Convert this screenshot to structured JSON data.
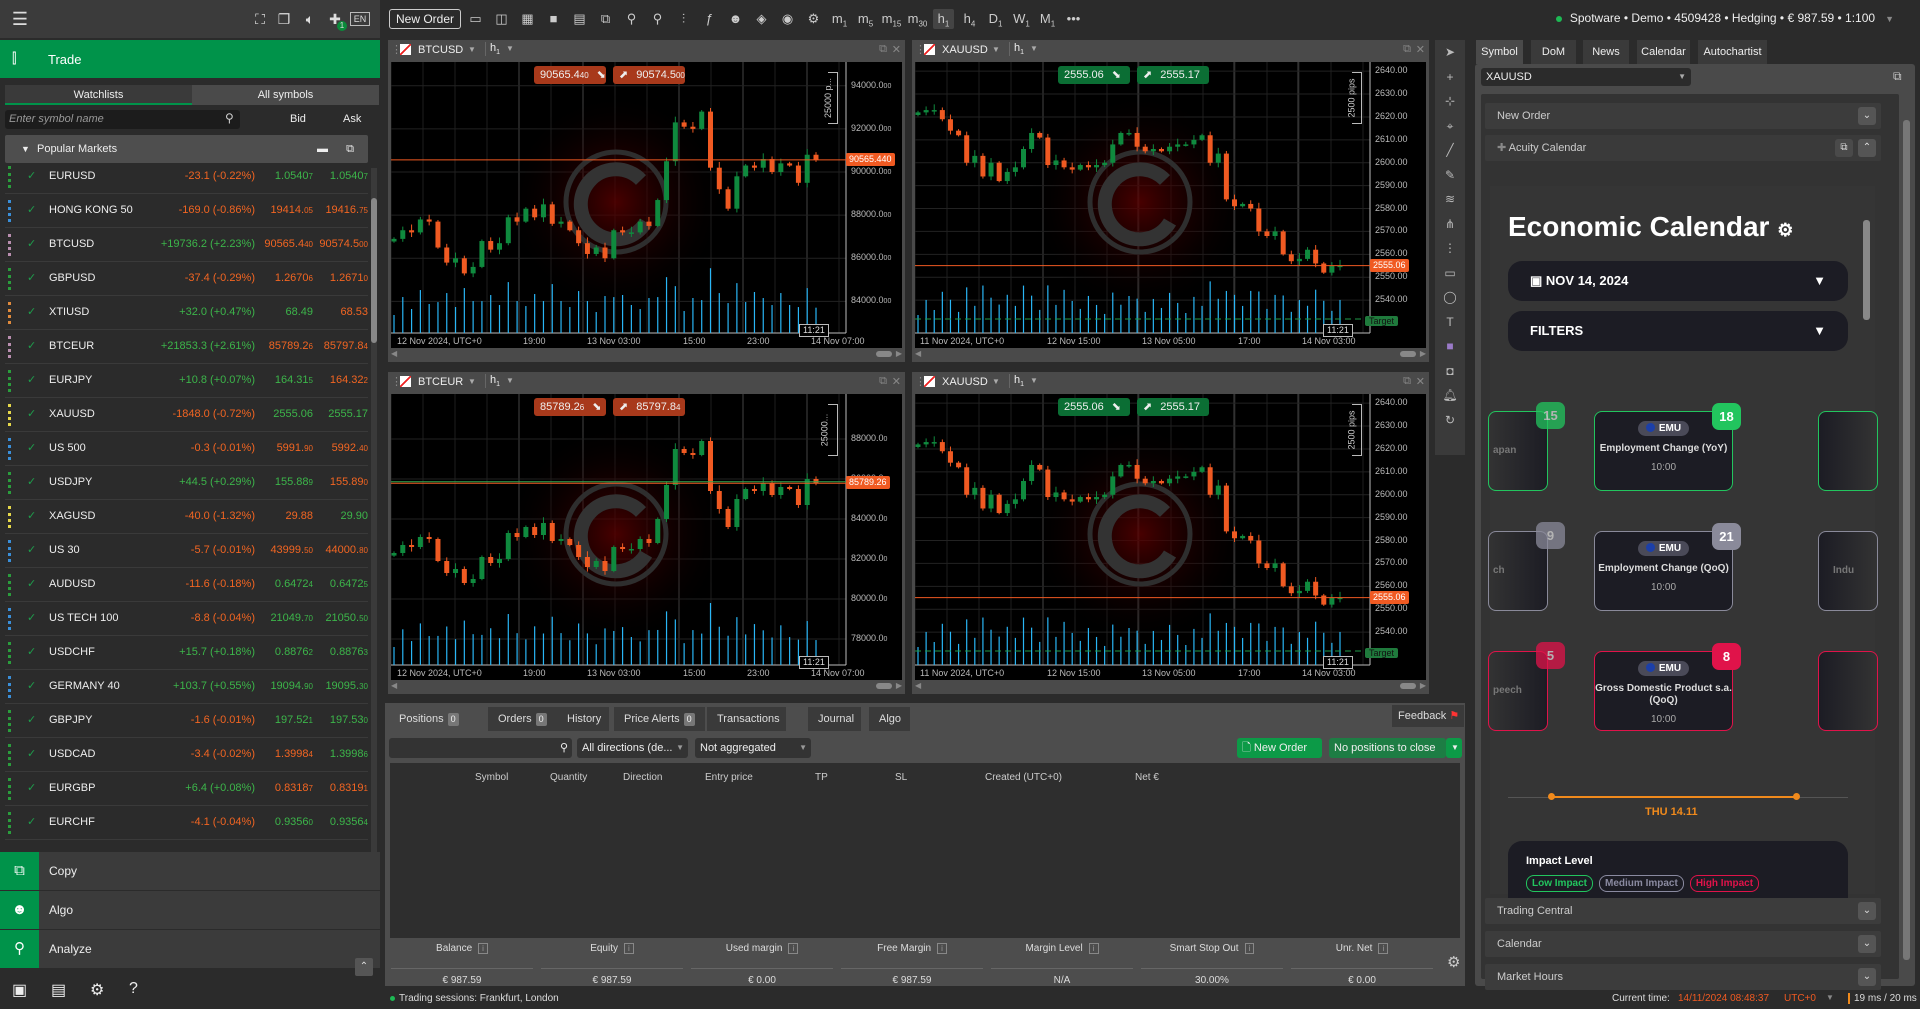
{
  "topbar": {
    "new_order": "New Order",
    "language": "EN",
    "plugin_badge": "1",
    "left_icons": [
      "fullscreen-icon",
      "duplicate-icon",
      "sound-icon",
      "plugin-icon"
    ],
    "tools": [
      {
        "name": "new-chart-icon",
        "g": "▭"
      },
      {
        "name": "layout-icon",
        "g": "◫"
      },
      {
        "name": "grid-4-icon",
        "g": "▦"
      },
      {
        "name": "single-view-icon",
        "g": "■"
      },
      {
        "name": "multi-view-icon",
        "g": "▤"
      },
      {
        "name": "add-chart-icon",
        "g": "⧉"
      },
      {
        "name": "zoom-out-icon",
        "g": "⚲"
      },
      {
        "name": "zoom-in-icon",
        "g": "⚲"
      },
      {
        "name": "chart-type-icon",
        "g": "⫶"
      },
      {
        "name": "indicator-icon",
        "g": "ƒ"
      },
      {
        "name": "bot-icon",
        "g": "☻"
      },
      {
        "name": "layers-icon",
        "g": "◈"
      },
      {
        "name": "eye-icon",
        "g": "◉"
      },
      {
        "name": "chart-settings-icon",
        "g": "⚙"
      }
    ],
    "timeframes": [
      {
        "l": "m",
        "s": "1"
      },
      {
        "l": "m",
        "s": "5"
      },
      {
        "l": "m",
        "s": "15"
      },
      {
        "l": "m",
        "s": "30"
      },
      {
        "l": "h",
        "s": "1"
      },
      {
        "l": "h",
        "s": "4"
      },
      {
        "l": "D",
        "s": "1"
      },
      {
        "l": "W",
        "s": "1"
      },
      {
        "l": "M",
        "s": "1"
      }
    ],
    "active_timeframe": "h1",
    "more": "•••",
    "account": "Spotware • Demo • 4509428 • Hedging • € 987.59 • 1:100"
  },
  "left": {
    "section": "Trade",
    "tabs": [
      "Watchlists",
      "All symbols"
    ],
    "active_tab": "Watchlists",
    "search_placeholder": "Enter symbol name",
    "bid": "Bid",
    "ask": "Ask",
    "group": "Popular Markets",
    "rows": [
      {
        "name": "EURUSD",
        "chg": "-23.1 (-0.22%)",
        "cd": "dn",
        "bid": "1.0540",
        "bs": "7",
        "bd": "up",
        "ask": "1.0540",
        "as": "7",
        "ad": "up",
        "bar": "#2a9d3c"
      },
      {
        "name": "HONG KONG 50",
        "chg": "-169.0 (-0.86%)",
        "cd": "dn",
        "bid": "19414.",
        "bs": "05",
        "bd": "dn",
        "ask": "19416.",
        "as": "75",
        "ad": "dn",
        "bar": "#3a8fd9"
      },
      {
        "name": "BTCUSD",
        "chg": "+19736.2 (+2.23%)",
        "cd": "up",
        "bid": "90565.4",
        "bs": "40",
        "bd": "dn",
        "ask": "90574.5",
        "as": "00",
        "ad": "dn",
        "bar": "#b98fb0"
      },
      {
        "name": "GBPUSD",
        "chg": "-37.4 (-0.29%)",
        "cd": "dn",
        "bid": "1.2670",
        "bs": "6",
        "bd": "dn",
        "ask": "1.2671",
        "as": "0",
        "ad": "dn",
        "bar": "#2a9d3c"
      },
      {
        "name": "XTIUSD",
        "chg": "+32.0 (+0.47%)",
        "cd": "up",
        "bid": "68.49",
        "bs": "",
        "bd": "up",
        "ask": "68.53",
        "as": "",
        "ad": "dn",
        "bar": "#e08a3c"
      },
      {
        "name": "BTCEUR",
        "chg": "+21853.3 (+2.61%)",
        "cd": "up",
        "bid": "85789.2",
        "bs": "6",
        "bd": "dn",
        "ask": "85797.8",
        "as": "4",
        "ad": "dn",
        "bar": "#b98fb0"
      },
      {
        "name": "EURJPY",
        "chg": "+10.8 (+0.07%)",
        "cd": "up",
        "bid": "164.31",
        "bs": "5",
        "bd": "up",
        "ask": "164.32",
        "as": "2",
        "ad": "dn",
        "bar": "#2a9d3c"
      },
      {
        "name": "XAUUSD",
        "chg": "-1848.0 (-0.72%)",
        "cd": "dn",
        "bid": "2555.06",
        "bs": "",
        "bd": "up",
        "ask": "2555.17",
        "as": "",
        "ad": "up",
        "bar": "#e6d84a"
      },
      {
        "name": "US 500",
        "chg": "-0.3 (-0.01%)",
        "cd": "dn",
        "bid": "5991.",
        "bs": "90",
        "bd": "dn",
        "ask": "5992.",
        "as": "40",
        "ad": "dn",
        "bar": "#3a8fd9"
      },
      {
        "name": "USDJPY",
        "chg": "+44.5 (+0.29%)",
        "cd": "up",
        "bid": "155.88",
        "bs": "9",
        "bd": "up",
        "ask": "155.89",
        "as": "0",
        "ad": "dn",
        "bar": "#2a9d3c"
      },
      {
        "name": "XAGUSD",
        "chg": "-40.0 (-1.32%)",
        "cd": "dn",
        "bid": "29.88",
        "bs": "",
        "bd": "dn",
        "ask": "29.90",
        "as": "",
        "ad": "up",
        "bar": "#e6d84a"
      },
      {
        "name": "US 30",
        "chg": "-5.7 (-0.01%)",
        "cd": "dn",
        "bid": "43999.",
        "bs": "50",
        "bd": "dn",
        "ask": "44000.",
        "as": "80",
        "ad": "dn",
        "bar": "#3a8fd9"
      },
      {
        "name": "AUDUSD",
        "chg": "-11.6 (-0.18%)",
        "cd": "dn",
        "bid": "0.6472",
        "bs": "4",
        "bd": "up",
        "ask": "0.6472",
        "as": "5",
        "ad": "up",
        "bar": "#2a9d3c"
      },
      {
        "name": "US TECH 100",
        "chg": "-8.8 (-0.04%)",
        "cd": "dn",
        "bid": "21049.",
        "bs": "70",
        "bd": "up",
        "ask": "21050.",
        "as": "50",
        "ad": "up",
        "bar": "#3a8fd9"
      },
      {
        "name": "USDCHF",
        "chg": "+15.7 (+0.18%)",
        "cd": "up",
        "bid": "0.8876",
        "bs": "2",
        "bd": "up",
        "ask": "0.8876",
        "as": "3",
        "ad": "up",
        "bar": "#2a9d3c"
      },
      {
        "name": "GERMANY 40",
        "chg": "+103.7 (+0.55%)",
        "cd": "up",
        "bid": "19094.",
        "bs": "90",
        "bd": "up",
        "ask": "19095.",
        "as": "30",
        "ad": "up",
        "bar": "#3a8fd9"
      },
      {
        "name": "GBPJPY",
        "chg": "-1.6 (-0.01%)",
        "cd": "dn",
        "bid": "197.52",
        "bs": "1",
        "bd": "up",
        "ask": "197.53",
        "as": "0",
        "ad": "up",
        "bar": "#2a9d3c"
      },
      {
        "name": "USDCAD",
        "chg": "-3.4 (-0.02%)",
        "cd": "dn",
        "bid": "1.3998",
        "bs": "4",
        "bd": "dn",
        "ask": "1.3998",
        "as": "6",
        "ad": "up",
        "bar": "#2a9d3c"
      },
      {
        "name": "EURGBP",
        "chg": "+6.4 (+0.08%)",
        "cd": "up",
        "bid": "0.8318",
        "bs": "7",
        "bd": "dn",
        "ask": "0.8319",
        "as": "1",
        "ad": "dn",
        "bar": "#2a9d3c"
      },
      {
        "name": "EURCHF",
        "chg": "-4.1 (-0.04%)",
        "cd": "dn",
        "bid": "0.9356",
        "bs": "0",
        "bd": "up",
        "ask": "0.9356",
        "as": "4",
        "ad": "up",
        "bar": "#2a9d3c"
      }
    ],
    "nav": [
      {
        "label": "Copy",
        "icon": "copy-icon",
        "g": "⧉"
      },
      {
        "label": "Algo",
        "icon": "robot-icon",
        "g": "☻"
      },
      {
        "label": "Analyze",
        "icon": "analyze-icon",
        "g": "⚲"
      }
    ],
    "footer_icons": [
      {
        "name": "deposit-icon",
        "g": "▣"
      },
      {
        "name": "wallet-icon",
        "g": "▤"
      },
      {
        "name": "settings-icon",
        "g": "⚙"
      },
      {
        "name": "help-icon",
        "g": "?"
      }
    ]
  },
  "charts": [
    {
      "symbol": "BTCUSD",
      "tf": "h",
      "tf_sub": "1",
      "bid": "90565.4",
      "bid_sub": "40",
      "ask": "90574.5",
      "ask_sub": "00",
      "quote_color": "#a8391b",
      "price_tag": "90565.440",
      "price_color": "#f05a22",
      "y_ticks": [
        "94000.0",
        "92000.0",
        "90000.0",
        "88000.0",
        "86000.0",
        "84000.0"
      ],
      "tick_values": [
        94000,
        92000,
        90000,
        88000,
        86000,
        84000
      ],
      "tick_suffix": "00",
      "y_range": [
        83000,
        95100
      ],
      "x_labels": [
        "12 Nov 2024, UTC+0",
        "19:00",
        "13 Nov 03:00",
        "15:00",
        "23:00",
        "14 Nov 07:00"
      ],
      "time_tag": "11:21",
      "ruler": "25000 p...",
      "closes": [
        86900,
        87300,
        87200,
        87800,
        87700,
        86500,
        85800,
        86000,
        85300,
        85600,
        86800,
        86400,
        86700,
        87900,
        87700,
        88300,
        87900,
        88500,
        87600,
        87700,
        87300,
        86700,
        86200,
        86500,
        86000,
        87300,
        87200,
        87200,
        87700,
        87500,
        88700,
        90500,
        92300,
        92100,
        92000,
        92800,
        90200,
        89200,
        88300,
        89800,
        90300,
        90200,
        90600,
        90000,
        90400,
        90300,
        89500,
        90800,
        90565
      ]
    },
    {
      "symbol": "XAUUSD",
      "tf": "h",
      "tf_sub": "1",
      "bid": "2555.06",
      "bid_sub": "",
      "ask": "2555.17",
      "ask_sub": "",
      "quote_color": "#0b6e34",
      "price_tag": "2555.06",
      "price_color": "#f05a22",
      "y_ticks": [
        "2640.00",
        "2630.00",
        "2620.00",
        "2610.00",
        "2600.00",
        "2590.00",
        "2580.00",
        "2570.00",
        "2560.00",
        "2550.00",
        "2540.00"
      ],
      "tick_values": [
        2640,
        2630,
        2620,
        2610,
        2600,
        2590,
        2580,
        2570,
        2560,
        2550,
        2540
      ],
      "tick_suffix": "",
      "y_range": [
        2530,
        2644
      ],
      "x_labels": [
        "11 Nov 2024, UTC+0",
        "12 Nov 15:00",
        "13 Nov 05:00",
        "17:00",
        "14 Nov 03:00"
      ],
      "time_tag": "11:21",
      "ruler": "2500 pips",
      "target": "Target",
      "closes": [
        2622,
        2623,
        2623,
        2619,
        2614,
        2612,
        2600,
        2603,
        2594,
        2600,
        2592,
        2596,
        2598,
        2606,
        2613,
        2611,
        2599,
        2601,
        2598,
        2597,
        2599,
        2598,
        2599,
        2600,
        2608,
        2613,
        2613,
        2607,
        2605,
        2606,
        2605,
        2607,
        2608,
        2608,
        2610,
        2612,
        2600,
        2604,
        2584,
        2581,
        2582,
        2580,
        2570,
        2568,
        2570,
        2560,
        2557,
        2558,
        2562,
        2556,
        2552,
        2555,
        2555.06
      ]
    },
    {
      "symbol": "BTCEUR",
      "tf": "h",
      "tf_sub": "1",
      "bid": "85789.2",
      "bid_sub": "6",
      "ask": "85797.8",
      "ask_sub": "4",
      "quote_color": "#a8391b",
      "price_tag": "85789.26",
      "price_color": "#f05a22",
      "second_line": "#2fa84f",
      "y_ticks": [
        "88000.0",
        "86000.0",
        "84000.0",
        "82000.0",
        "80000.0",
        "78000.0"
      ],
      "tick_values": [
        88000,
        86000,
        84000,
        82000,
        80000,
        78000
      ],
      "tick_suffix": "0",
      "y_range": [
        77200,
        90250
      ],
      "x_labels": [
        "12 Nov 2024, UTC+0",
        "19:00",
        "13 Nov 03:00",
        "15:00",
        "23:00",
        "14 Nov 07:00"
      ],
      "time_tag": "11:21",
      "ruler": "25000...",
      "closes": [
        82300,
        82700,
        82600,
        83100,
        83000,
        81900,
        81300,
        81500,
        80800,
        81000,
        82100,
        81800,
        82000,
        83300,
        83100,
        83600,
        83200,
        83800,
        82900,
        83000,
        82700,
        82100,
        81600,
        81900,
        81400,
        82600,
        82500,
        82500,
        83000,
        82800,
        84000,
        85700,
        87500,
        87300,
        87200,
        87900,
        85400,
        84500,
        83600,
        85000,
        85500,
        85400,
        85800,
        85200,
        85600,
        85500,
        84700,
        86000,
        85789
      ]
    },
    {
      "symbol": "XAUUSD",
      "tf": "h",
      "tf_sub": "1",
      "bid": "2555.06",
      "bid_sub": "",
      "ask": "2555.17",
      "ask_sub": "",
      "quote_color": "#0b6e34",
      "price_tag": "2555.06",
      "price_color": "#f05a22",
      "y_ticks": [
        "2640.00",
        "2630.00",
        "2620.00",
        "2610.00",
        "2600.00",
        "2590.00",
        "2580.00",
        "2570.00",
        "2560.00",
        "2550.00",
        "2540.00"
      ],
      "tick_values": [
        2640,
        2630,
        2620,
        2610,
        2600,
        2590,
        2580,
        2570,
        2560,
        2550,
        2540
      ],
      "tick_suffix": "",
      "y_range": [
        2530,
        2644
      ],
      "x_labels": [
        "11 Nov 2024, UTC+0",
        "12 Nov 15:00",
        "13 Nov 05:00",
        "17:00",
        "14 Nov 03:00"
      ],
      "time_tag": "11:21",
      "ruler": "2500 pips",
      "target": "Target",
      "closes": [
        2622,
        2623,
        2623,
        2619,
        2614,
        2612,
        2600,
        2603,
        2594,
        2600,
        2592,
        2596,
        2598,
        2606,
        2613,
        2611,
        2599,
        2601,
        2598,
        2597,
        2599,
        2598,
        2599,
        2600,
        2608,
        2613,
        2613,
        2607,
        2605,
        2606,
        2605,
        2607,
        2608,
        2608,
        2610,
        2612,
        2600,
        2604,
        2584,
        2581,
        2582,
        2580,
        2570,
        2568,
        2570,
        2560,
        2557,
        2558,
        2562,
        2556,
        2552,
        2555,
        2555.06
      ]
    }
  ],
  "drawing_tools": [
    "cursor-icon",
    "crosshair-icon",
    "crosshair-plus-icon",
    "crosshair-box-icon",
    "trendline-icon",
    "pencil-icon",
    "fibonacci-icon",
    "pitchfork-icon",
    "grid-lines-icon",
    "rectangle-icon",
    "ellipse-icon",
    "text-icon",
    "color-swatch-icon",
    "camera-icon",
    "alert-bell-icon",
    "history-icon"
  ],
  "bottom": {
    "tabs": [
      {
        "label": "Positions",
        "count": "0"
      },
      {
        "label": "Orders",
        "count": "0"
      },
      {
        "label": "History"
      },
      {
        "label": "Price Alerts",
        "count": "0"
      },
      {
        "label": "Transactions"
      },
      {
        "label": "Journal"
      },
      {
        "label": "Algo"
      }
    ],
    "feedback": "Feedback",
    "directions": "All directions (de...",
    "aggregation": "Not aggregated",
    "new_order": "New Order",
    "close_all": "No positions to close",
    "columns": [
      "Symbol",
      "Quantity",
      "Direction",
      "Entry price",
      "TP",
      "SL",
      "Created (UTC+0)",
      "Net €"
    ],
    "stats": [
      {
        "label": "Balance",
        "value": "€ 987.59"
      },
      {
        "label": "Equity",
        "value": "€ 987.59"
      },
      {
        "label": "Used margin",
        "value": "€ 0.00"
      },
      {
        "label": "Free Margin",
        "value": "€ 987.59"
      },
      {
        "label": "Margin Level",
        "value": "N/A"
      },
      {
        "label": "Smart Stop Out",
        "value": "30.00%"
      },
      {
        "label": "Unr. Net",
        "value": "€ 0.00"
      }
    ],
    "sessions": "Trading sessions: Frankfurt, London"
  },
  "right": {
    "tabs": [
      "Symbol",
      "DoM",
      "News",
      "Calendar",
      "Autochartist"
    ],
    "active_tab": "Symbol",
    "symbol": "XAUUSD",
    "new_order": "New Order",
    "acuity": "Acuity Calendar",
    "calendar": {
      "title": "Economic Calendar",
      "date": "NOV 14, 2024",
      "filters": "FILTERS",
      "rows": [
        {
          "color": "#22c55e",
          "left_badge": "15",
          "left_text": "apan",
          "badge": "18",
          "country": "EMU",
          "title": "Employment Change (YoY)",
          "time": "10:00",
          "right_text": ""
        },
        {
          "color": "#8a8a9a",
          "left_badge": "9",
          "left_text": "ch",
          "badge": "21",
          "country": "EMU",
          "title": "Employment Change (QoQ)",
          "time": "10:00",
          "right_text": "Indu"
        },
        {
          "color": "#e0134a",
          "left_badge": "5",
          "left_text": "peech",
          "badge": "8",
          "country": "EMU",
          "title": "Gross Domestic Product s.a. (QoQ)",
          "time": "10:00",
          "right_text": ""
        }
      ],
      "day": "THU 14.11",
      "impact_title": "Impact Level",
      "impact": [
        {
          "label": "Low Impact",
          "color": "#22c55e"
        },
        {
          "label": "Medium Impact",
          "color": "#8a8aa0"
        },
        {
          "label": "High Impact",
          "color": "#e0134a"
        }
      ]
    },
    "accordions": [
      "Trading Central",
      "Calendar",
      "Market Hours"
    ]
  },
  "status": {
    "current_time_label": "Current time:",
    "time": "14/11/2024 08:48:37",
    "tz": "UTC+0",
    "latency": "19 ms / 20 ms"
  }
}
